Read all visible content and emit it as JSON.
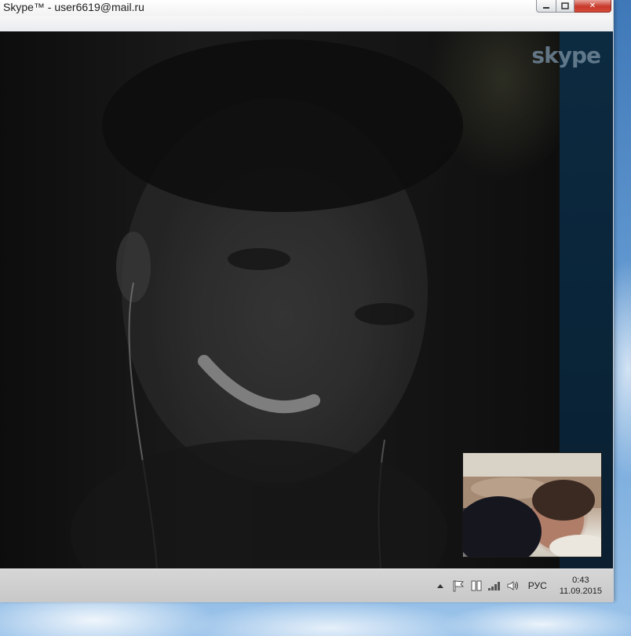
{
  "window": {
    "title": "Skype™ - user6619@mail.ru",
    "controls": {
      "minimize": "▭",
      "maximize": "◫",
      "close": "✕"
    }
  },
  "call": {
    "logo_text": "skype",
    "remote_video": "remote-participant-video",
    "self_view": "self-view-video"
  },
  "taskbar": {
    "tray_icons": [
      "show-hidden-icons-icon",
      "action-center-flag-icon",
      "network-adapter-icon",
      "signal-bars-icon",
      "volume-icon"
    ],
    "language": "РУС",
    "time": "0:43",
    "date": "11.09.2015"
  },
  "colors": {
    "close_button": "#c7392b",
    "stage_bg": "#0c2a40",
    "taskbar_bg": "#cccccc"
  }
}
